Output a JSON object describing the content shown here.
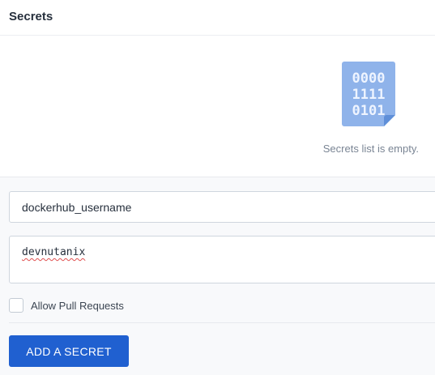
{
  "header": {
    "title": "Secrets"
  },
  "empty_state": {
    "icon": "binary-file-icon",
    "icon_digits": [
      "0000",
      "1111",
      "0101"
    ],
    "message": "Secrets list is empty."
  },
  "form": {
    "secret_name": {
      "value": "dockerhub_username"
    },
    "secret_value": {
      "value": "devnutanix"
    },
    "allow_pull_requests": {
      "label": "Allow Pull Requests",
      "checked": false
    },
    "add_button_label": "ADD A SECRET"
  },
  "colors": {
    "accent": "#2060d0",
    "icon_blue": "#8fb3ea",
    "icon_digits": "#eef4ff"
  }
}
